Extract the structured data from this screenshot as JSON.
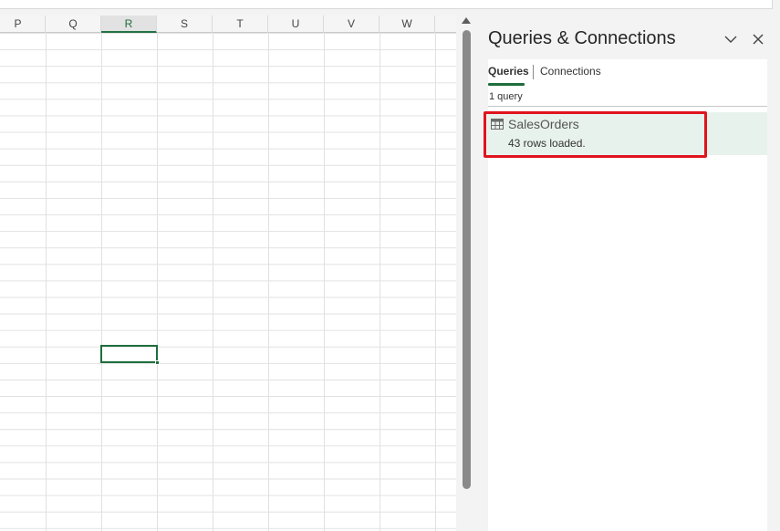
{
  "spreadsheet": {
    "columns": [
      "P",
      "Q",
      "R",
      "S",
      "T",
      "U",
      "V",
      "W"
    ],
    "active_column": "R",
    "colors": {
      "active_accent": "#1e6e3c",
      "grid_line": "#e1e1e1"
    }
  },
  "pane": {
    "title": "Queries & Connections",
    "collapse_icon": "chevron-down-icon",
    "close_icon": "close-icon",
    "tabs": [
      {
        "label": "Queries",
        "active": true
      },
      {
        "label": "Connections",
        "active": false
      }
    ],
    "query_count": "1 query",
    "queries": [
      {
        "name": "SalesOrders",
        "status": "43 rows loaded.",
        "icon": "table-icon"
      }
    ],
    "colors": {
      "selected_item_bg": "#e8f2ec",
      "highlight_border": "#e0141e"
    }
  }
}
